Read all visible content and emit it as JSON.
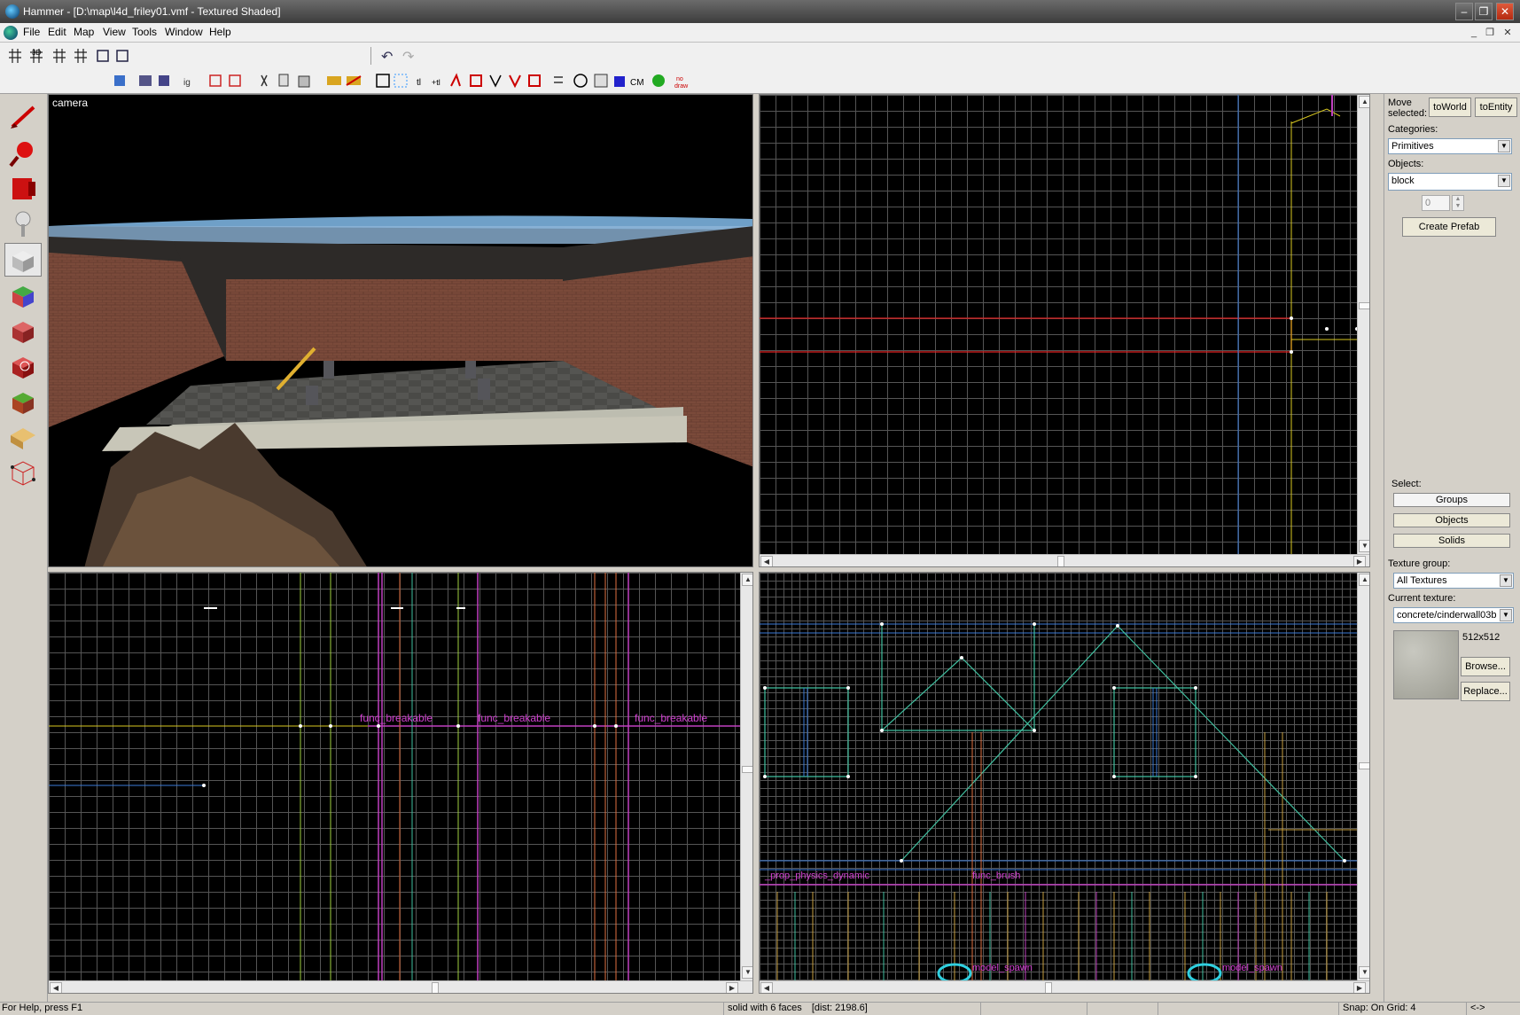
{
  "window": {
    "title": "Hammer - [D:\\map\\l4d_friley01.vmf - Textured Shaded]",
    "controls": {
      "minimize": "–",
      "restore": "❐",
      "close": "✕"
    }
  },
  "menu": [
    "File",
    "Edit",
    "Map",
    "View",
    "Tools",
    "Window",
    "Help"
  ],
  "toolbar2_text": {
    "cm": "CM",
    "nodraw": "no draw"
  },
  "viewports": {
    "camera": {
      "label": "camera"
    },
    "side": {
      "entity_labels": [
        "func_breakable",
        "func_breakable",
        "func_breakable"
      ]
    },
    "front": {
      "entity_labels": [
        "_prop_physics_dynamic",
        "func_brush",
        "model_spawn",
        "model_spawn"
      ]
    }
  },
  "right_panel": {
    "move_selected_label": "Move selected:",
    "to_world": "toWorld",
    "to_entity": "toEntity",
    "categories_label": "Categories:",
    "categories_value": "Primitives",
    "objects_label": "Objects:",
    "objects_value": "block",
    "spinner_value": "0",
    "create_prefab": "Create Prefab",
    "select_label": "Select:",
    "select_groups": "Groups",
    "select_objects": "Objects",
    "select_solids": "Solids",
    "texture_group_label": "Texture group:",
    "texture_group_value": "All Textures",
    "current_texture_label": "Current texture:",
    "current_texture_value": "concrete/cinderwall03b",
    "texture_size": "512x512",
    "browse": "Browse...",
    "replace": "Replace..."
  },
  "status": {
    "help": "For Help, press F1",
    "selection": "solid with 6 faces",
    "dist": "[dist: 2198.6]",
    "snap": "Snap: On Grid: 4",
    "arrows": "<->"
  }
}
